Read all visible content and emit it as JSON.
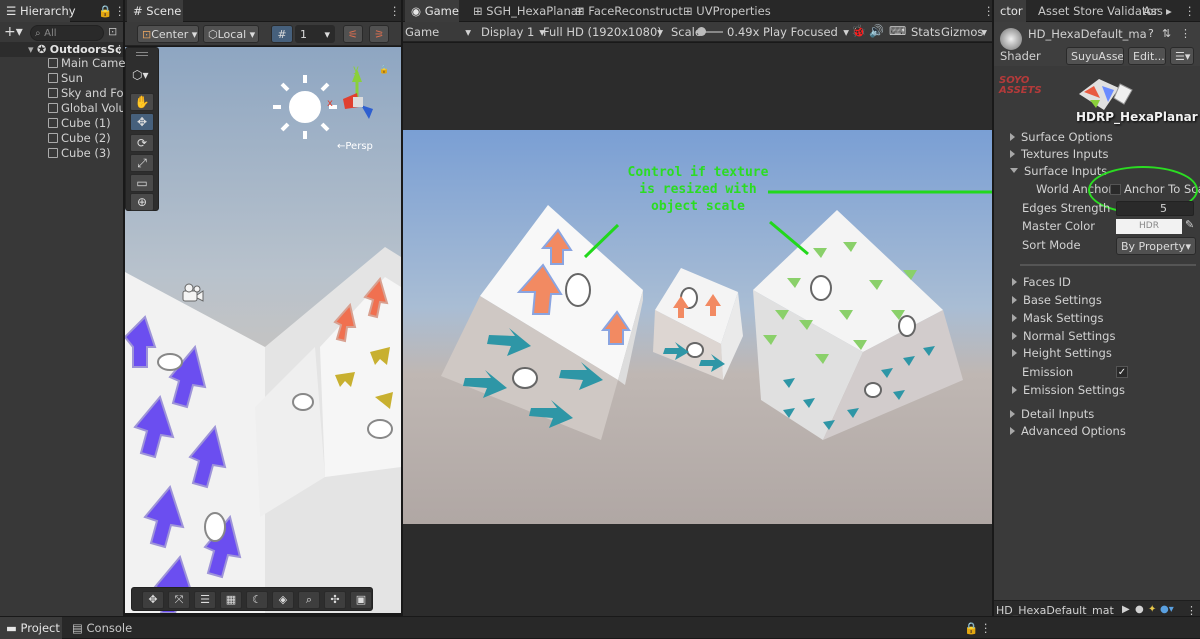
{
  "hierarchy": {
    "tab": "Hierarchy",
    "search_placeholder": "All",
    "scene_name": "OutdoorsSc",
    "items": [
      "Main Camera",
      "Sun",
      "Sky and Fog V",
      "Global Volume",
      "Cube (1)",
      "Cube (2)",
      "Cube (3)"
    ]
  },
  "scene": {
    "tab": "Scene",
    "pivot": "Center",
    "space": "Local",
    "grid_value": "1",
    "persp_label": "←Persp",
    "gizmo_axes": {
      "y": "y",
      "x": "x"
    }
  },
  "game": {
    "tabs": [
      "Game",
      "SGH_HexaPlanar",
      "FaceReconstruct",
      "UVProperties"
    ],
    "display_mode": "Game",
    "display": "Display 1",
    "resolution": "Full HD (1920x1080)",
    "scale_label": "Scale",
    "scale_value": "0.49x",
    "play_mode": "Play Focused",
    "stats": "Stats",
    "gizmos": "Gizmos",
    "annotation": "Control if texture\nis resized with\nobject scale"
  },
  "inspector": {
    "tabs": [
      "ctor",
      "Asset Store Validator",
      "Ass"
    ],
    "material_name": "HD_HexaDefault_mat (Mater",
    "shader_label": "Shader",
    "shader_value": "SuyuAsse▾",
    "edit_button": "Edit...",
    "logo_text": "SOYO ASSETS",
    "banner_title": "HDRP_HexaPlanar",
    "sections_top": [
      "Surface Options",
      "Textures Inputs",
      "Surface Inputs"
    ],
    "world_anchor": "World Anchor",
    "anchor_to_scale": "Anchor To Scale",
    "edges_strength_label": "Edges Strength",
    "edges_strength_value": "5",
    "master_color_label": "Master Color",
    "master_color_value": "HDR",
    "sort_mode_label": "Sort Mode",
    "sort_mode_value": "By Property",
    "sub_sections": [
      "Faces ID",
      "Base Settings",
      "Mask Settings",
      "Normal Settings",
      "Height Settings"
    ],
    "emission_label": "Emission",
    "emission_settings": "Emission Settings",
    "sections_bottom": [
      "Detail Inputs",
      "Advanced Options"
    ],
    "footer_name": "HD_HexaDefault_mat"
  },
  "bottom": {
    "tabs": [
      "Project",
      "Console"
    ]
  },
  "colors": {
    "highlight": "#2bdc22",
    "accent": "#46607c"
  }
}
